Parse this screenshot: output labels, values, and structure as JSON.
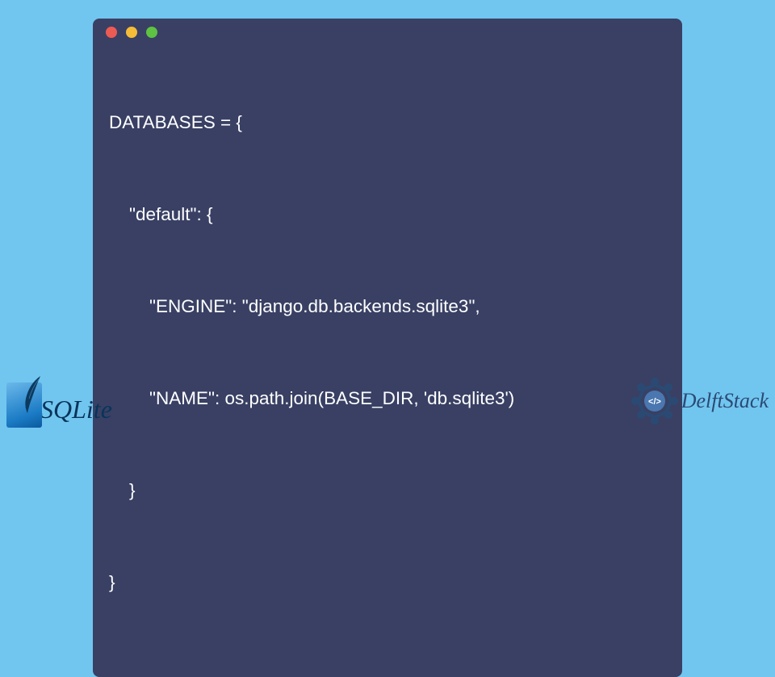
{
  "code": {
    "lines": [
      "DATABASES = {",
      "    \"default\": {",
      "        \"ENGINE\": \"django.db.backends.sqlite3\",",
      "        \"NAME\": os.path.join(BASE_DIR, 'db.sqlite3')",
      "    }",
      "}"
    ]
  },
  "logos": {
    "sqlite": "SQLite",
    "delftstack": "DelftStack"
  },
  "colors": {
    "bg": "#71c6f0",
    "window": "#394064",
    "dot_red": "#ec5a54",
    "dot_yellow": "#f5bc38",
    "dot_green": "#5ec242"
  }
}
